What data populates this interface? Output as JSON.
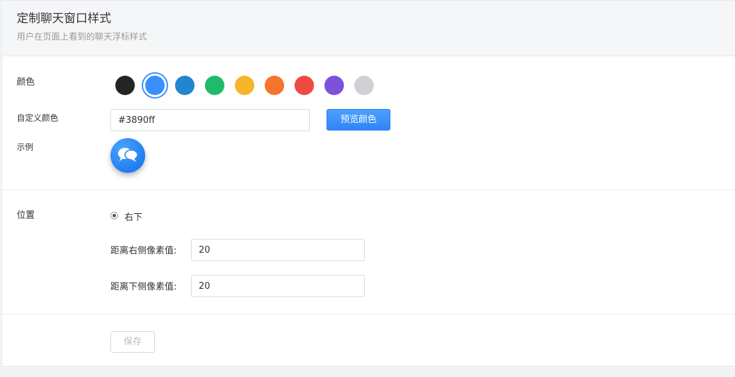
{
  "header": {
    "title": "定制聊天窗口样式",
    "subtitle": "用户在页面上看到的聊天浮标样式"
  },
  "color_section": {
    "label": "颜色",
    "selected_index": 1,
    "swatches": [
      {
        "name": "black",
        "hex": "#242424"
      },
      {
        "name": "blue",
        "hex": "#3890ff"
      },
      {
        "name": "dark-blue",
        "hex": "#2185d0"
      },
      {
        "name": "green",
        "hex": "#21ba6b"
      },
      {
        "name": "yellow",
        "hex": "#f7b52b"
      },
      {
        "name": "orange",
        "hex": "#f6752a"
      },
      {
        "name": "red",
        "hex": "#ef4b43"
      },
      {
        "name": "purple",
        "hex": "#7a52dc"
      },
      {
        "name": "grey",
        "hex": "#cfd1d6"
      }
    ]
  },
  "custom_color": {
    "label": "自定义颜色",
    "value": "#3890ff",
    "preview_button": "预览颜色"
  },
  "example": {
    "label": "示例",
    "icon": "chat-bubbles-icon"
  },
  "position_section": {
    "label": "位置",
    "option_label": "右下",
    "right_offset_label": "距离右侧像素值:",
    "right_offset_value": "20",
    "bottom_offset_label": "距离下侧像素值:",
    "bottom_offset_value": "20"
  },
  "footer": {
    "save_button": "保存"
  }
}
